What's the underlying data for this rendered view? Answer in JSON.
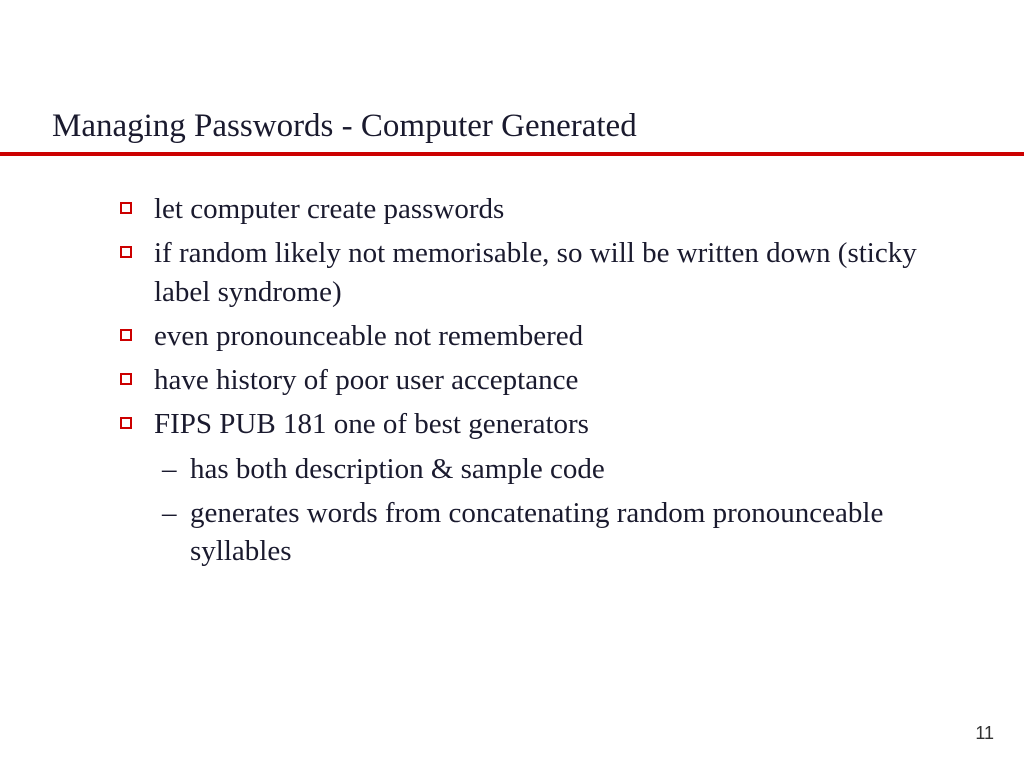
{
  "title": "Managing Passwords - Computer Generated",
  "bullets": [
    {
      "text": "let computer create passwords"
    },
    {
      "text": "if random likely not memorisable, so will be written down (sticky label syndrome)"
    },
    {
      "text": "even pronounceable not remembered"
    },
    {
      "text": "have history of poor user acceptance"
    },
    {
      "text": "FIPS PUB 181 one of best generators"
    }
  ],
  "subbullets": [
    {
      "text": "has both description & sample code"
    },
    {
      "text": "generates words from concatenating random pronounceable syllables"
    }
  ],
  "page_number": "11"
}
